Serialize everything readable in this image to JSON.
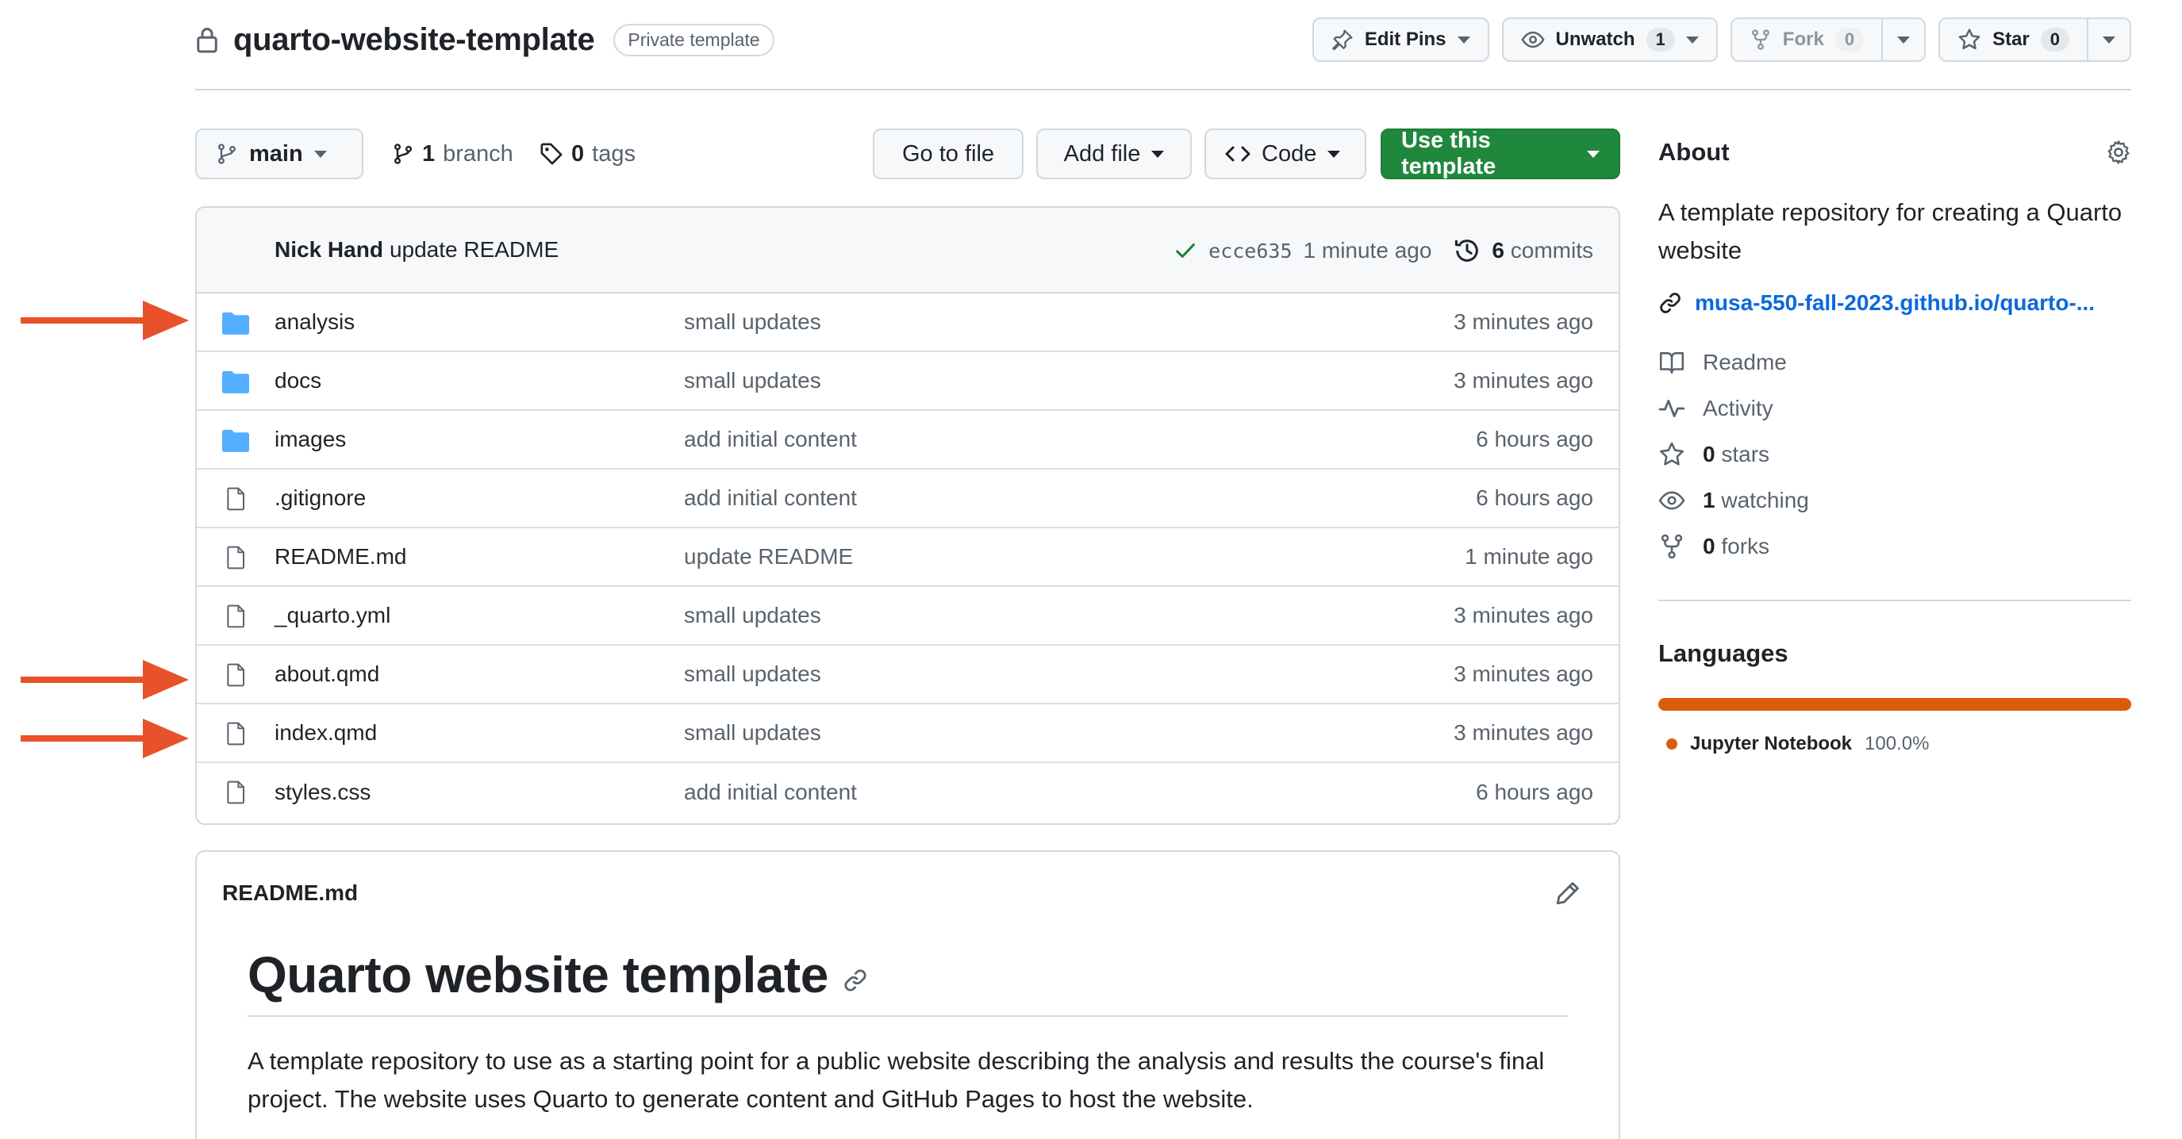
{
  "repo": {
    "name": "quarto-website-template",
    "badge": "Private template"
  },
  "header_actions": {
    "edit_pins": "Edit Pins",
    "unwatch": "Unwatch",
    "unwatch_count": "1",
    "fork": "Fork",
    "fork_count": "0",
    "star": "Star",
    "star_count": "0"
  },
  "toolbar": {
    "branch": "main",
    "branches_count": "1",
    "branches_label": "branch",
    "tags_count": "0",
    "tags_label": "tags",
    "go_to_file": "Go to file",
    "add_file": "Add file",
    "code": "Code",
    "use_template": "Use this template"
  },
  "latest_commit": {
    "author": "Nick Hand",
    "message": "update README",
    "sha": "ecce635",
    "time": "1 minute ago",
    "commits_count": "6",
    "commits_label": "commits"
  },
  "files": [
    {
      "type": "folder",
      "name": "analysis",
      "message": "small updates",
      "age": "3 minutes ago"
    },
    {
      "type": "folder",
      "name": "docs",
      "message": "small updates",
      "age": "3 minutes ago"
    },
    {
      "type": "folder",
      "name": "images",
      "message": "add initial content",
      "age": "6 hours ago"
    },
    {
      "type": "file",
      "name": ".gitignore",
      "message": "add initial content",
      "age": "6 hours ago"
    },
    {
      "type": "file",
      "name": "README.md",
      "message": "update README",
      "age": "1 minute ago"
    },
    {
      "type": "file",
      "name": "_quarto.yml",
      "message": "small updates",
      "age": "3 minutes ago"
    },
    {
      "type": "file",
      "name": "about.qmd",
      "message": "small updates",
      "age": "3 minutes ago"
    },
    {
      "type": "file",
      "name": "index.qmd",
      "message": "small updates",
      "age": "3 minutes ago"
    },
    {
      "type": "file",
      "name": "styles.css",
      "message": "add initial content",
      "age": "6 hours ago"
    }
  ],
  "readme": {
    "filename": "README.md",
    "heading": "Quarto website template",
    "paragraph": "A template repository to use as a starting point for a public website describing the analysis and results the course's final project. The website uses Quarto to generate content and GitHub Pages to host the website."
  },
  "about": {
    "title": "About",
    "description": "A template repository for creating a Quarto website",
    "link": "musa-550-fall-2023.github.io/quarto-...",
    "readme": "Readme",
    "activity": "Activity",
    "stars_count": "0",
    "stars_label": "stars",
    "watching_count": "1",
    "watching_label": "watching",
    "forks_count": "0",
    "forks_label": "forks"
  },
  "languages": {
    "title": "Languages",
    "items": [
      {
        "name": "Jupyter Notebook",
        "percent": "100.0%",
        "color": "#da5b0b"
      }
    ]
  },
  "annotations": {
    "arrow_color": "#e8522a",
    "arrow_targets": [
      "analysis",
      "about.qmd",
      "index.qmd"
    ]
  },
  "colors": {
    "primary_green": "#1f883d",
    "link_blue": "#0969da",
    "folder_blue": "#54aeff",
    "check_green": "#1a7f37"
  }
}
